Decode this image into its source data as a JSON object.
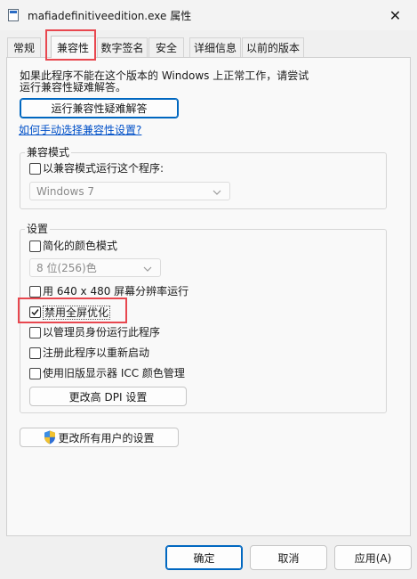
{
  "window": {
    "title": "mafiadefinitiveedition.exe 属性",
    "close_glyph": "✕"
  },
  "tabs": [
    {
      "label": "常规"
    },
    {
      "label": "兼容性",
      "active": true
    },
    {
      "label": "数字签名"
    },
    {
      "label": "安全"
    },
    {
      "label": "详细信息"
    },
    {
      "label": "以前的版本"
    }
  ],
  "intro": {
    "line1": "如果此程序不能在这个版本的 Windows 上正常工作，请尝试",
    "line2": "运行兼容性疑难解答。"
  },
  "run_troubleshooter_label": "运行兼容性疑难解答",
  "manual_link": "如何手动选择兼容性设置?",
  "compat_mode": {
    "group_label": "兼容模式",
    "checkbox_label": "以兼容模式运行这个程序:",
    "checked": false,
    "selected_os": "Windows 7"
  },
  "settings": {
    "group_label": "设置",
    "reduced_color": {
      "label": "简化的颜色模式",
      "checked": false
    },
    "color_select": "8 位(256)色",
    "res_640": {
      "label": "用 640 x 480 屏幕分辨率运行",
      "checked": false
    },
    "disable_fullscreen_opt": {
      "label": "禁用全屏优化",
      "checked": true
    },
    "run_as_admin": {
      "label": "以管理员身份运行此程序",
      "checked": false
    },
    "register_restart": {
      "label": "注册此程序以重新启动",
      "checked": false
    },
    "legacy_icc": {
      "label": "使用旧版显示器 ICC 颜色管理",
      "checked": false
    },
    "change_dpi_label": "更改高 DPI 设置"
  },
  "change_all_users_label": "更改所有用户的设置",
  "footer": {
    "ok": "确定",
    "cancel": "取消",
    "apply": "应用(A)"
  },
  "colors": {
    "accent": "#0067c0",
    "highlight": "#e8474f",
    "link": "#0050c8"
  },
  "icons": {
    "app": "exe-file-icon",
    "close": "close-icon",
    "uac": "uac-shield-icon",
    "dropdown": "chevron-down-icon",
    "check": "checkmark-icon"
  }
}
